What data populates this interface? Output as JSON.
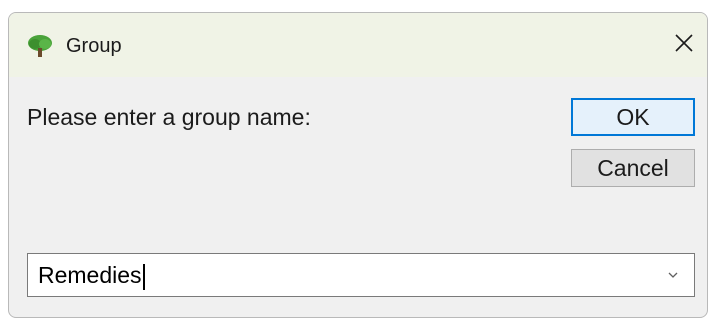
{
  "window": {
    "title": "Group",
    "icon": "tree-icon",
    "close_icon": "close-icon"
  },
  "prompt": {
    "text": "Please enter a group name:"
  },
  "buttons": {
    "ok_label": "OK",
    "cancel_label": "Cancel"
  },
  "group_name_field": {
    "value": "Remedies",
    "dropdown_icon": "chevron-down-icon"
  },
  "colors": {
    "titlebar_bg": "#f0f3e6",
    "dialog_bg": "#f0f0f0",
    "default_button_border": "#0078d7",
    "tree_icon_green": "#4aa33a"
  }
}
